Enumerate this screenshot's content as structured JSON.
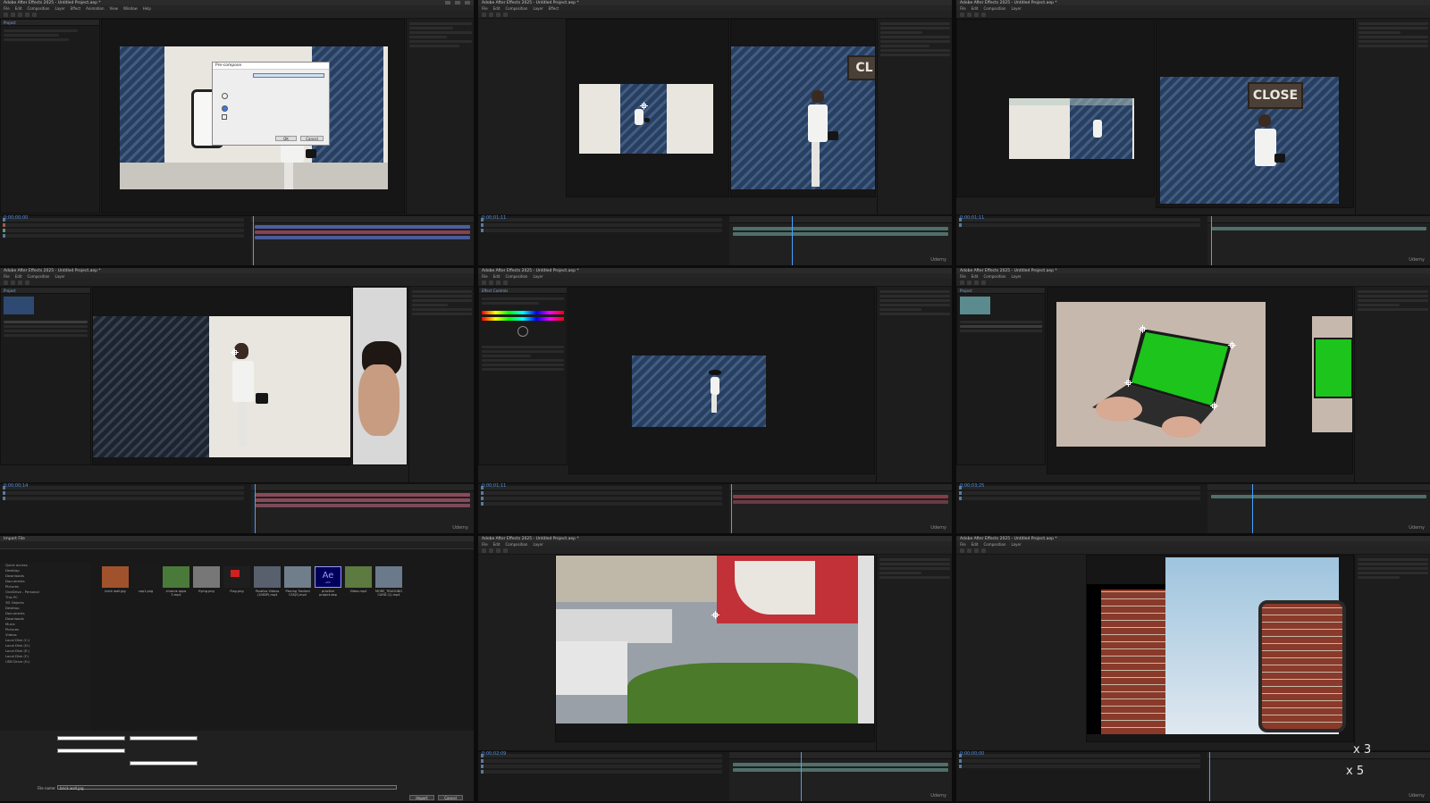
{
  "app": {
    "window_title": "Adobe After Effects 2025 - Untitled Project.aep *",
    "menu": [
      "File",
      "Edit",
      "Composition",
      "Layer",
      "Effect",
      "Animation",
      "View",
      "Window",
      "Help"
    ],
    "watermark": "Udemy"
  },
  "frames": [
    {
      "timecode": "0;00;00;00",
      "dialog_title": "Pre-compose",
      "dialog_ok": "OK",
      "dialog_cancel": "Cancel"
    },
    {
      "timecode": "0;00;01;11",
      "sign_text": "CL"
    },
    {
      "timecode": "0;00;01;11",
      "sign_text": "CLOSE"
    },
    {
      "timecode": "0;00;00;14"
    },
    {
      "timecode": "0;00;01;11"
    },
    {
      "timecode": "0;00;03;25"
    },
    {
      "dialog_title": "Import File",
      "tiles": [
        {
          "label": "brick wall.jpg"
        },
        {
          "label": "cap1.png"
        },
        {
          "label": "chrome apps 3.mp4"
        },
        {
          "label": "flying.png"
        },
        {
          "label": "Flag.png"
        },
        {
          "label": "Parallax Videos (1080P).mp4"
        },
        {
          "label": "Placing Tracked CSS(f).mp4"
        },
        {
          "label": "practice project.aep"
        },
        {
          "label": "Video.mp4"
        },
        {
          "label": "MORE_TRACKING CARD (1).mp4"
        }
      ],
      "ae_icon_text": "Ae",
      "ae_icon_sub": "AEP",
      "file_name_label": "File name:",
      "file_name_value": "brick wall.jpg",
      "btn_import": "Import",
      "btn_cancel": "Cancel",
      "tree": [
        "Quick access",
        "Desktop",
        "Downloads",
        "Documents",
        "Pictures",
        "OneDrive - Personal",
        "This PC",
        "3D Objects",
        "Desktop",
        "Documents",
        "Downloads",
        "Music",
        "Pictures",
        "Videos",
        "Local Disk (C:)",
        "Local Disk (D:)",
        "Local Disk (E:)",
        "Local Disk (F:)",
        "USB Drive (G:)"
      ]
    },
    {
      "timecode": "0;00;02;09"
    },
    {
      "timecode": "0;00;00;00",
      "counter_a": "x 3",
      "counter_b": "x 5"
    }
  ]
}
